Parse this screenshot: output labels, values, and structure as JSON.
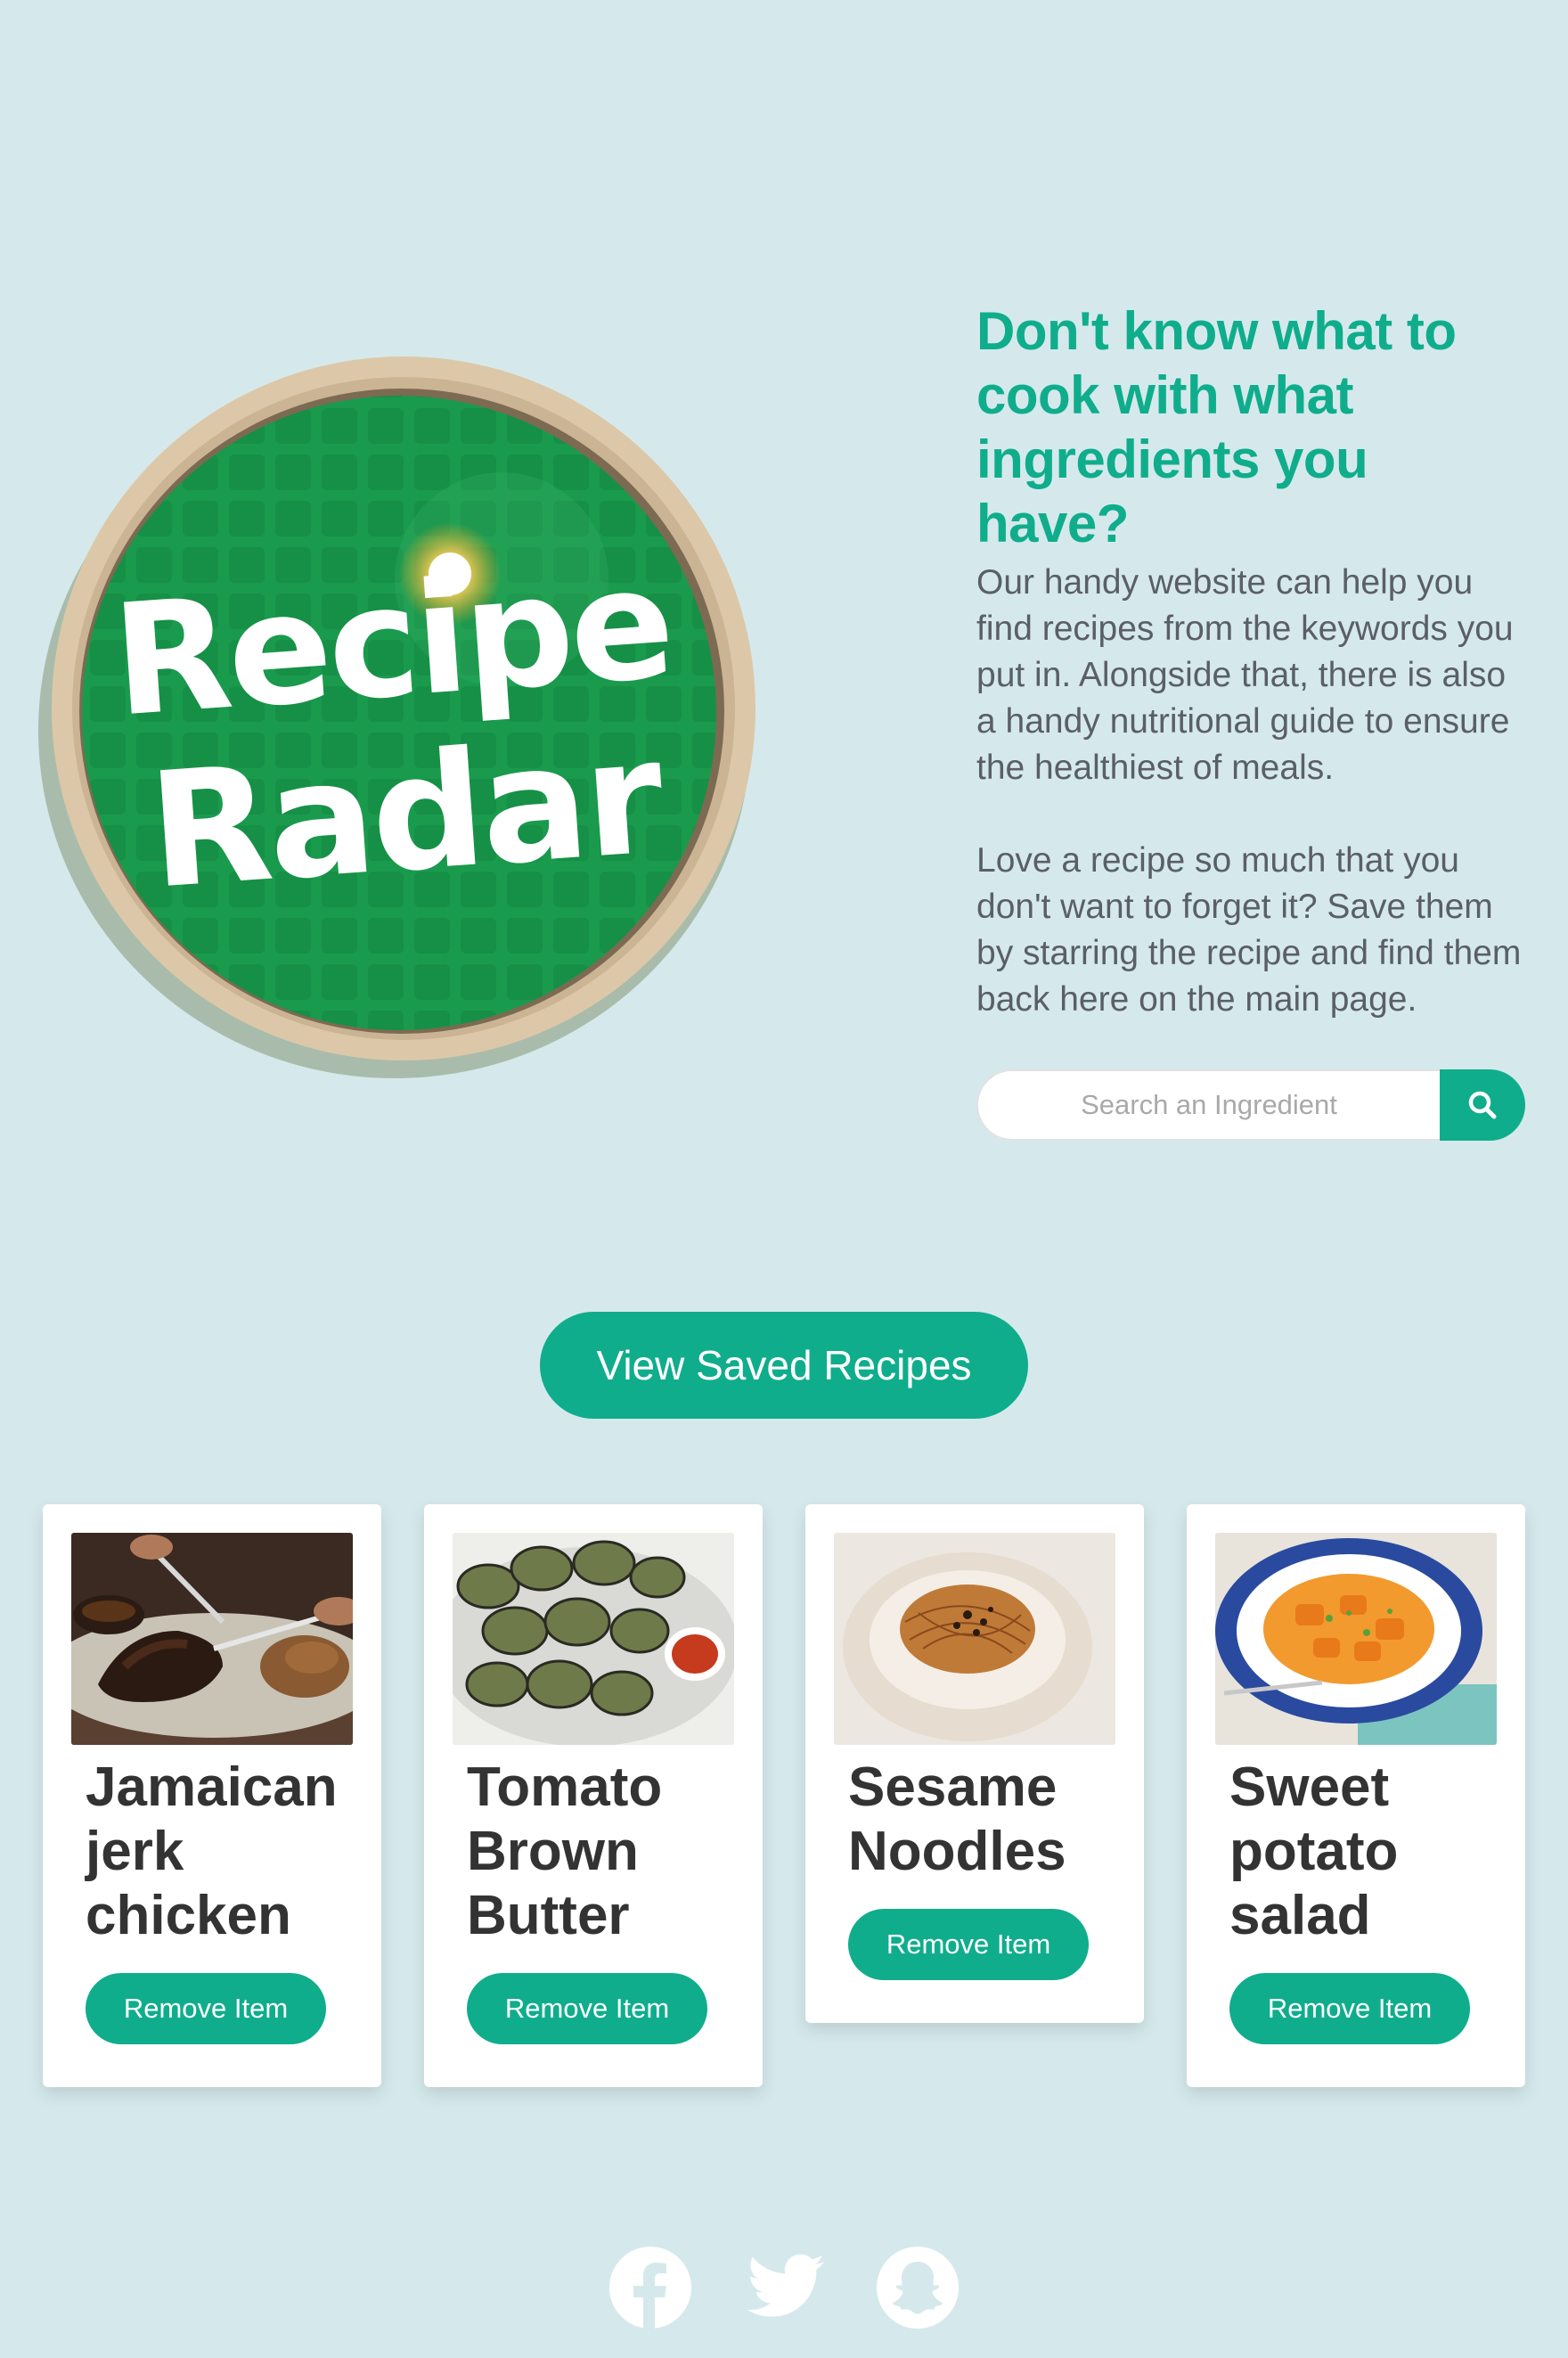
{
  "brand": {
    "logo_line1": "Recipe",
    "logo_line2": "Radar"
  },
  "intro": {
    "heading": "Don't know what to cook with what ingredients you have?",
    "paragraph1": "Our handy website can help you find recipes from the keywords you put in. Alongside that, there is also a handy nutritional guide to ensure the healthiest of meals.",
    "paragraph2": "Love a recipe so much that you don't want to forget it? Save them by starring the recipe and find them back here on the main page."
  },
  "search": {
    "placeholder": "Search an Ingredient",
    "value": "",
    "button_icon": "search-icon"
  },
  "view_saved_label": "View Saved Recipes",
  "saved_recipes": [
    {
      "title": "Jamaican jerk chicken",
      "remove_label": "Remove Item",
      "image": "jerk-chicken-photo"
    },
    {
      "title": "Tomato Brown Butter",
      "remove_label": "Remove Item",
      "image": "grilled-aubergine-photo"
    },
    {
      "title": "Sesame Noodles",
      "remove_label": "Remove Item",
      "image": "sesame-noodles-photo"
    },
    {
      "title": "Sweet potato salad",
      "remove_label": "Remove Item",
      "image": "sweet-potato-salad-photo"
    }
  ],
  "footer": {
    "socials": [
      "facebook-icon",
      "twitter-icon",
      "snapchat-icon"
    ]
  },
  "colors": {
    "background": "#d5e9ec",
    "accent": "#0fad8c",
    "logo_green": "#1a9a4d",
    "card": "#ffffff"
  }
}
